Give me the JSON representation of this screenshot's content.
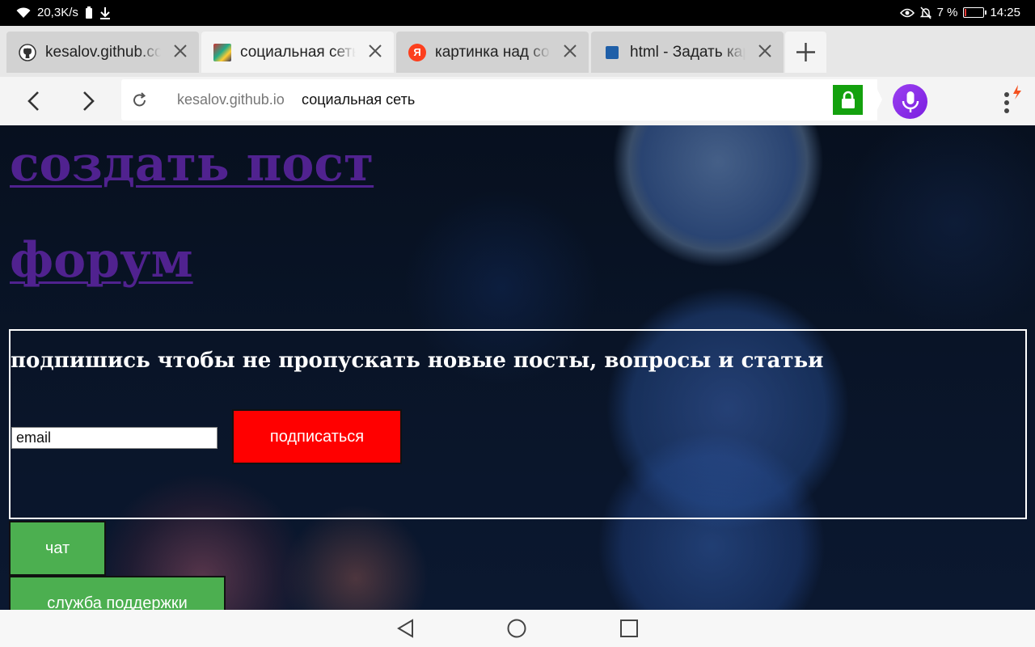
{
  "status_bar": {
    "speed": "20,3K/s",
    "battery_percent": "7 %",
    "battery_level": 0.07,
    "time": "14:25",
    "icons": [
      "wifi-icon",
      "battery-saver-icon",
      "download-icon",
      "eye-icon",
      "mute-notifications-icon",
      "battery-icon"
    ]
  },
  "tabs": [
    {
      "title": "kesalov.github.com",
      "icon": "github-icon",
      "active": false
    },
    {
      "title": "социальная сеть",
      "icon": "site-favicon",
      "active": true
    },
    {
      "title": "картинка над со",
      "icon": "yandex-icon",
      "active": false
    },
    {
      "title": "html - Задать кар",
      "icon": "stackoverflow-icon",
      "active": false
    }
  ],
  "omnibox": {
    "domain": "kesalov.github.io",
    "title": "социальная сеть"
  },
  "page": {
    "links": [
      "создать пост",
      "форум"
    ],
    "subscribe": {
      "heading": "подпишись чтобы не пропускать новые посты, вопросы и статьи",
      "email_value": "email",
      "button": "подписаться"
    },
    "buttons": [
      "чат",
      "служба поддержки"
    ]
  },
  "colors": {
    "link": "#50228f",
    "subscribe_button": "#ff0000",
    "green_button": "#4caf50",
    "secure_lock": "#14a10e",
    "voice_button": "#8a2be2"
  }
}
